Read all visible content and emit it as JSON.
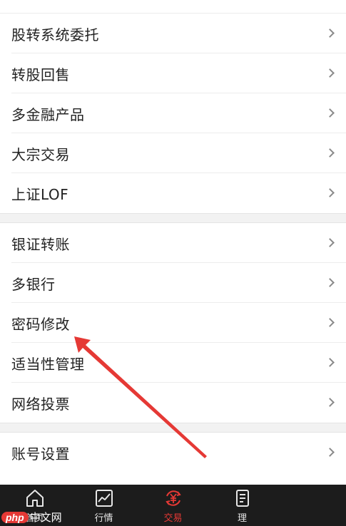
{
  "menu": {
    "group1": [
      {
        "label": "股转系统委托"
      },
      {
        "label": "转股回售"
      },
      {
        "label": "多金融产品"
      },
      {
        "label": "大宗交易"
      },
      {
        "label": "上证LOF"
      }
    ],
    "group2": [
      {
        "label": "银证转账"
      },
      {
        "label": "多银行"
      },
      {
        "label": "密码修改"
      },
      {
        "label": "适当性管理"
      },
      {
        "label": "网络投票"
      }
    ],
    "group3": [
      {
        "label": "账号设置"
      }
    ]
  },
  "tabbar": {
    "items": [
      {
        "label": "首页",
        "icon": "home-icon"
      },
      {
        "label": "行情",
        "icon": "chart-icon"
      },
      {
        "label": "交易",
        "icon": "yen-exchange-icon",
        "active": true
      },
      {
        "label": "理",
        "icon": "document-icon"
      }
    ]
  },
  "colors": {
    "accent": "#e53935",
    "tabbar_bg": "#1c1c1c",
    "annotation_arrow": "#e53935"
  },
  "watermark": {
    "badge": "php",
    "text": "中文网"
  }
}
